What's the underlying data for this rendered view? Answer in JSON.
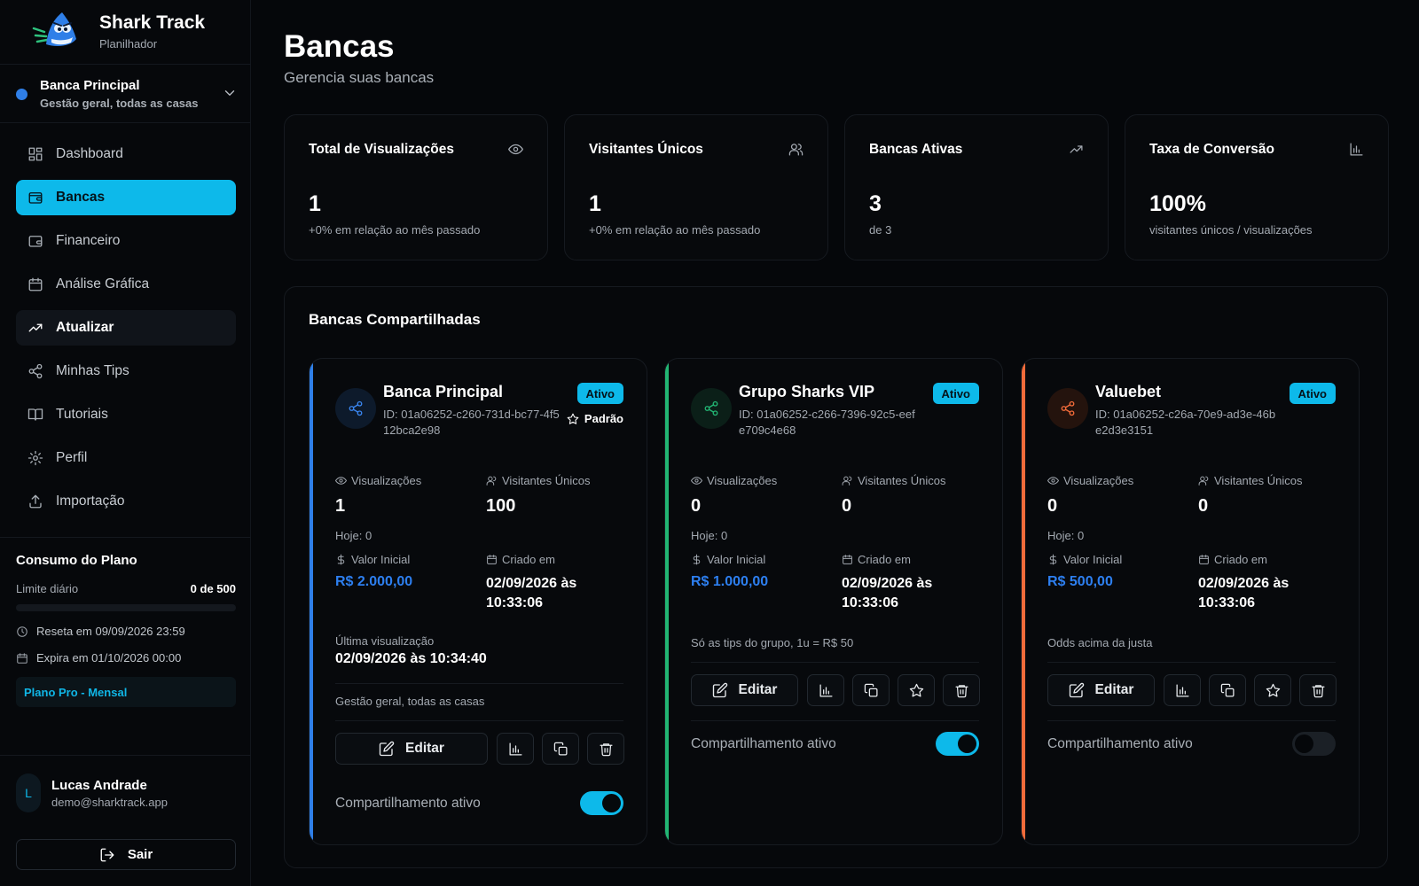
{
  "app": {
    "name": "Shark Track",
    "subtitle": "Planilhador"
  },
  "current_bank": {
    "name": "Banca Principal",
    "description": "Gestão geral, todas as casas",
    "color": "#2f7fe8"
  },
  "nav": [
    {
      "label": "Dashboard",
      "icon": "dashboard-icon"
    },
    {
      "label": "Bancas",
      "icon": "wallet-icon",
      "active": true
    },
    {
      "label": "Financeiro",
      "icon": "wallet-icon"
    },
    {
      "label": "Análise Gráfica",
      "icon": "calendar-icon"
    },
    {
      "label": "Atualizar",
      "icon": "trending-up-icon"
    },
    {
      "label": "Minhas Tips",
      "icon": "share-icon"
    },
    {
      "label": "Tutoriais",
      "icon": "book-icon"
    },
    {
      "label": "Perfil",
      "icon": "gear-icon"
    },
    {
      "label": "Importação",
      "icon": "upload-icon"
    }
  ],
  "plan": {
    "title": "Consumo do Plano",
    "limit_label": "Limite diário",
    "limit_value": "0 de 500",
    "usage_fraction": 0,
    "reset": "Reseta em 09/09/2026 23:59",
    "expires": "Expira em 01/10/2026 00:00",
    "badge": "Plano Pro - Mensal"
  },
  "user": {
    "initial": "L",
    "name": "Lucas Andrade",
    "email": "demo@sharktrack.app",
    "logout_label": "Sair"
  },
  "page": {
    "title": "Bancas",
    "subtitle": "Gerencia suas bancas"
  },
  "stats": [
    {
      "label": "Total de Visualizações",
      "icon": "eye-icon",
      "value": "1",
      "sub": "+0% em relação ao mês passado"
    },
    {
      "label": "Visitantes Únicos",
      "icon": "users-icon",
      "value": "1",
      "sub": "+0% em relação ao mês passado"
    },
    {
      "label": "Bancas Ativas",
      "icon": "trending-up-icon",
      "value": "3",
      "sub": "de 3"
    },
    {
      "label": "Taxa de Conversão",
      "icon": "bar-chart-icon",
      "value": "100%",
      "sub": "visitantes únicos / visualizações"
    }
  ],
  "shared": {
    "title": "Bancas Compartilhadas",
    "labels": {
      "views": "Visualizações",
      "unique": "Visitantes Únicos",
      "initial_value": "Valor Inicial",
      "created": "Criado em",
      "last_view": "Última visualização",
      "edit": "Editar",
      "sharing": "Compartilhamento ativo",
      "default": "Padrão"
    },
    "cards": [
      {
        "name": "Banca Principal",
        "id": "ID: 01a06252-c260-731d-bc77-4f512bca2e98",
        "status": "Ativo",
        "is_default": true,
        "accent": "#2f7fe8",
        "views": "1",
        "today": "Hoje: 0",
        "unique": "100",
        "initial_value": "R$ 2.000,00",
        "created": "02/09/2026 às 10:33:06",
        "last_view": "02/09/2026 às 10:34:40",
        "description": "Gestão geral, todas as casas",
        "sharing": true
      },
      {
        "name": "Grupo Sharks VIP",
        "id": "ID: 01a06252-c266-7396-92c5-eefe709c4e68",
        "status": "Ativo",
        "is_default": false,
        "accent": "#22b573",
        "views": "0",
        "today": "Hoje: 0",
        "unique": "0",
        "initial_value": "R$ 1.000,00",
        "created": "02/09/2026 às 10:33:06",
        "description": "Só as tips do grupo, 1u = R$ 50",
        "sharing": true
      },
      {
        "name": "Valuebet",
        "id": "ID: 01a06252-c26a-70e9-ad3e-46be2d3e3151",
        "status": "Ativo",
        "is_default": false,
        "accent": "#f26b3a",
        "views": "0",
        "today": "Hoje: 0",
        "unique": "0",
        "initial_value": "R$ 500,00",
        "created": "02/09/2026 às 10:33:06",
        "description": "Odds acima da justa",
        "sharing": false
      }
    ]
  }
}
